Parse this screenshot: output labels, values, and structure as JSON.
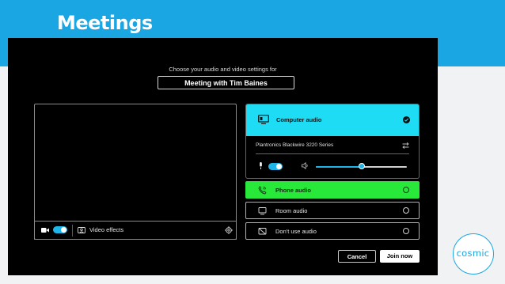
{
  "slide": {
    "title": "Meetings"
  },
  "dialog": {
    "prompt": "Choose your audio and video settings for",
    "meeting_title": "Meeting with Tim Baines"
  },
  "video": {
    "camera_enabled": true,
    "effects_label": "Video effects"
  },
  "audio": {
    "computer": {
      "label": "Computer audio",
      "selected": true,
      "device": "Plantronics Blackwire 3220 Series",
      "mic_enabled": true,
      "volume_fraction": 0.5
    },
    "options": [
      {
        "label": "Phone audio",
        "icon": "phone-icon",
        "highlighted": true
      },
      {
        "label": "Room audio",
        "icon": "room-device-icon",
        "highlighted": false
      },
      {
        "label": "Don't use audio",
        "icon": "no-audio-icon",
        "highlighted": false
      }
    ]
  },
  "buttons": {
    "cancel": "Cancel",
    "join": "Join now"
  },
  "logo": {
    "text": "cosmic"
  },
  "colors": {
    "brand_blue": "#1aa6e3",
    "accent_cyan": "#1fdcf5",
    "toggle_blue": "#1eb6e8",
    "highlight_green": "#28e93a"
  }
}
